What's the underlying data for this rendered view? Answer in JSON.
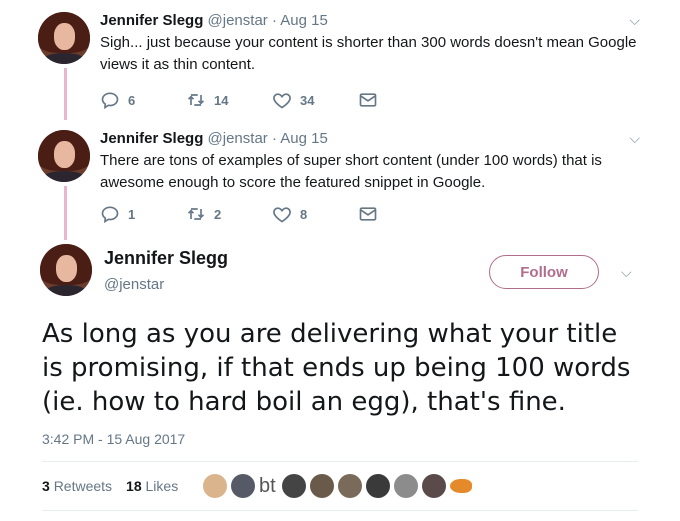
{
  "tweets": [
    {
      "name": "Jennifer Slegg",
      "handle": "@jenstar",
      "date": "Aug 15",
      "text": "Sigh... just because your content is shorter than 300 words doesn't mean Google views it as thin content.",
      "replies": "6",
      "retweets": "14",
      "likes": "34"
    },
    {
      "name": "Jennifer Slegg",
      "handle": "@jenstar",
      "date": "Aug 15",
      "text": "There are tons of examples of super short content (under 100 words) that is awesome enough to score the featured snippet in Google.",
      "replies": "1",
      "retweets": "2",
      "likes": "8"
    }
  ],
  "main": {
    "name": "Jennifer Slegg",
    "handle": "@jenstar",
    "follow_label": "Follow",
    "text": "As long as you are delivering what your title is promising, if that ends up being 100 words (ie. how to hard boil an egg), that's fine.",
    "timestamp": "3:42 PM - 15 Aug 2017",
    "retweet_count": "3",
    "retweet_label": "Retweets",
    "like_count": "18",
    "like_label": "Likes",
    "bt_avatar_text": "bt"
  },
  "sep": "·",
  "colors": {
    "accent": "#b26d8c",
    "thread_line": "#e8b7cf",
    "muted": "#657786"
  }
}
